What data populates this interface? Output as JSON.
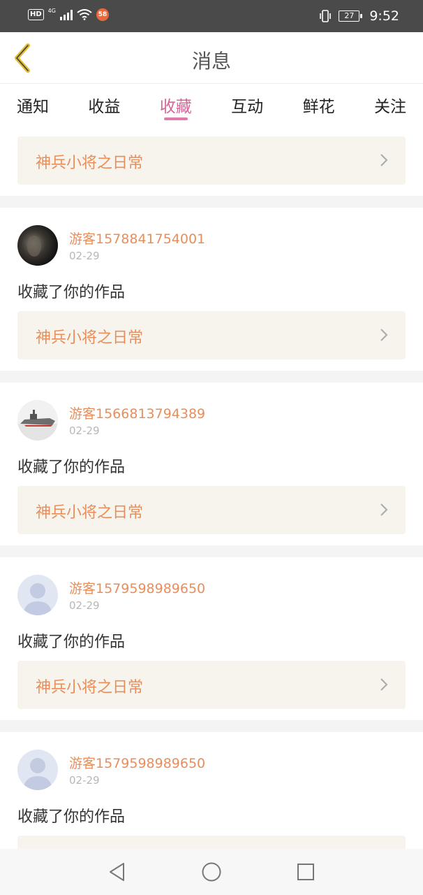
{
  "status_bar": {
    "hd": "HD",
    "network": "4G",
    "app_badge": "58",
    "battery": "27",
    "time": "9:52"
  },
  "header": {
    "title": "消息"
  },
  "tabs": [
    {
      "label": "通知"
    },
    {
      "label": "收益"
    },
    {
      "label": "收藏",
      "active": true
    },
    {
      "label": "互动"
    },
    {
      "label": "鲜花"
    },
    {
      "label": "关注"
    }
  ],
  "top_item": {
    "work_title": "神兵小将之日常"
  },
  "notices": [
    {
      "user": "游客1578841754001",
      "date": "02-29",
      "action": "收藏了你的作品",
      "work_title": "神兵小将之日常",
      "avatar": "dark-photo"
    },
    {
      "user": "游客1566813794389",
      "date": "02-29",
      "action": "收藏了你的作品",
      "work_title": "神兵小将之日常",
      "avatar": "warship-photo"
    },
    {
      "user": "游客1579598989650",
      "date": "02-29",
      "action": "收藏了你的作品",
      "work_title": "神兵小将之日常",
      "avatar": "default-user"
    },
    {
      "user": "游客1579598989650",
      "date": "02-29",
      "action": "收藏了你的作品",
      "work_title": "",
      "avatar": "default-user"
    }
  ],
  "colors": {
    "accent": "#d8649a",
    "work_text": "#e98e5a",
    "card_bg": "#f6f4ec",
    "status_bar": "#4a4a4a"
  }
}
